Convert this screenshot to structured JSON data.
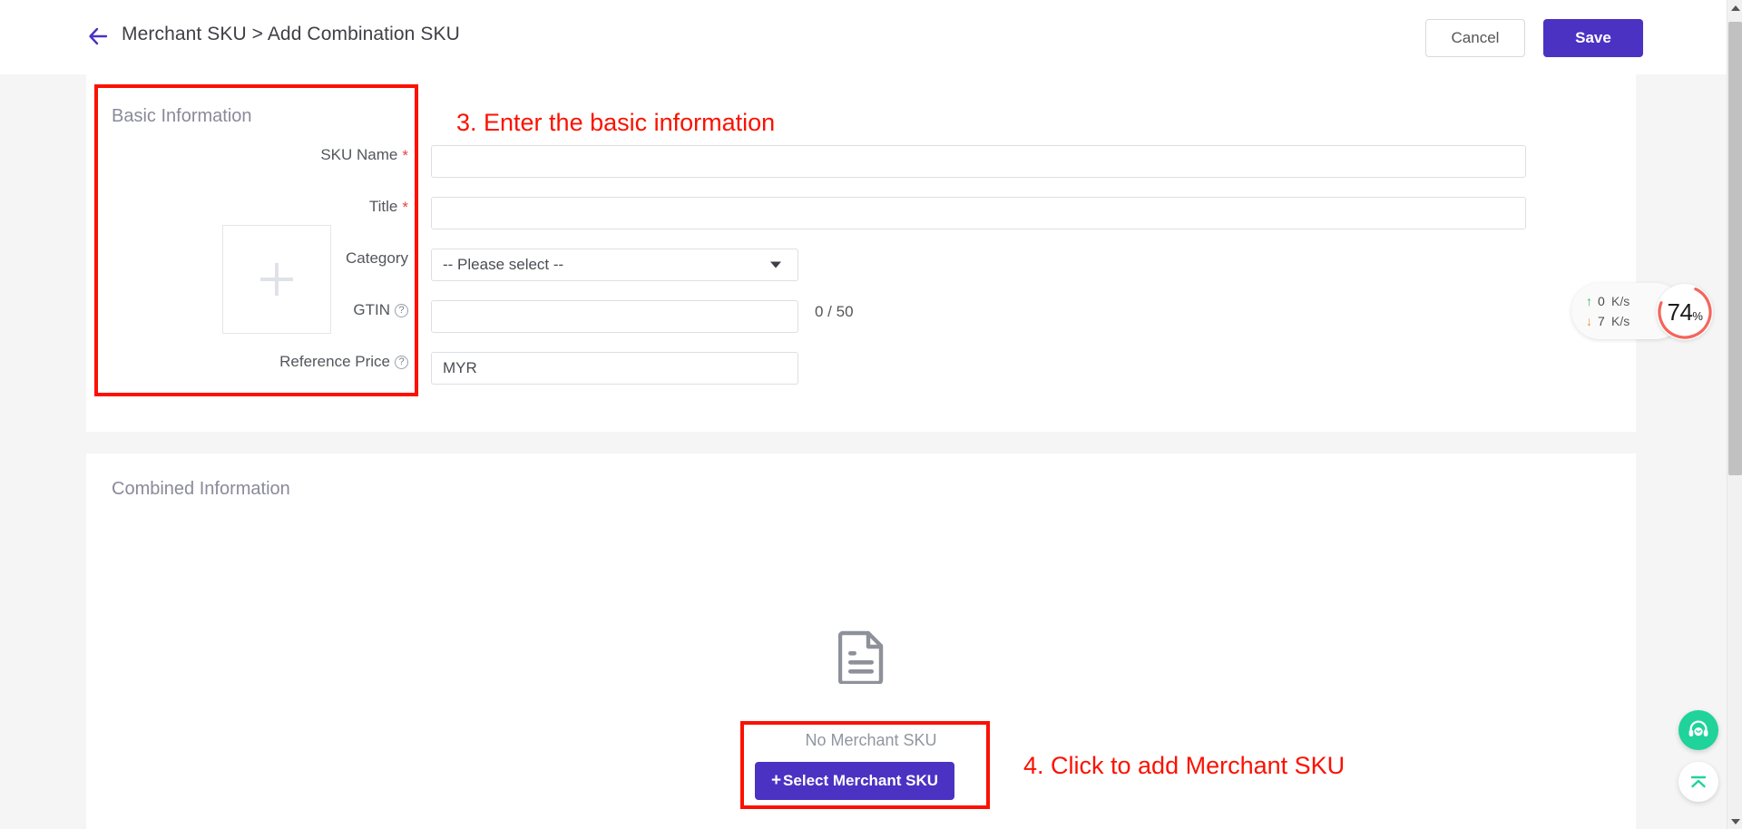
{
  "header": {
    "back_icon": "arrow-left-icon",
    "breadcrumb": "Merchant SKU > Add Combination SKU",
    "cancel_label": "Cancel",
    "save_label": "Save",
    "save_color": "#4b32c3"
  },
  "basic": {
    "title": "Basic Information",
    "upload_icon": "plus-icon",
    "fields": [
      {
        "label": "SKU Name",
        "required": "*",
        "value": "",
        "placeholder": ""
      },
      {
        "label": "Title",
        "required": "*",
        "value": "",
        "placeholder": ""
      },
      {
        "label": "Category",
        "selected": "-- Please select --"
      },
      {
        "label": "GTIN",
        "help_icon": "question-circle-icon",
        "value": "",
        "counter": "0 / 50"
      },
      {
        "label": "Reference Price",
        "help_icon": "question-circle-icon",
        "value": "MYR"
      }
    ]
  },
  "combined": {
    "title": "Combined Information",
    "empty_icon": "document-icon",
    "empty_text": "No Merchant SKU",
    "select_button": "Select Merchant SKU",
    "select_button_plus": "+"
  },
  "annotations": {
    "color": "#fb1100",
    "step3": "3. Enter the basic information",
    "step4": "4. Click to add Merchant SKU"
  },
  "net_widget": {
    "upload_arrow": "arrow-up-icon",
    "upload_value": "0",
    "upload_unit": "K/s",
    "download_arrow": "arrow-down-icon",
    "download_value": "7",
    "download_unit": "K/s",
    "percent": "74",
    "percent_symbol": "%",
    "ring_color": "#f4655c"
  },
  "floating": {
    "support_icon": "headset-icon",
    "scroll_top_icon": "chevron-up-bar-icon",
    "support_color": "#1fd39b"
  },
  "scrollbar": {
    "up_icon": "scroll-up-arrow-icon",
    "down_icon": "scroll-down-arrow-icon"
  }
}
